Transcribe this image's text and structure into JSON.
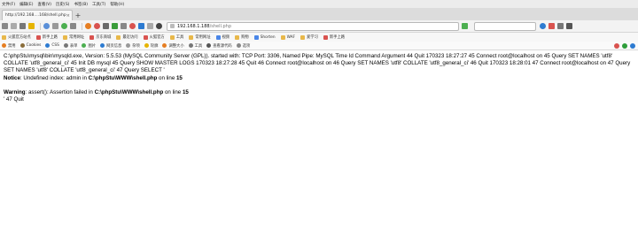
{
  "menu": {
    "items": [
      "文件(F)",
      "编辑(E)",
      "查看(V)",
      "历史(S)",
      "书签(B)",
      "工具(T)",
      "帮助(H)"
    ]
  },
  "tab": {
    "title": "http://192.168....168/shell.php",
    "close": "×",
    "new": "+"
  },
  "nav": {
    "url_host": "192.168.1.188",
    "url_path": "/shell.php"
  },
  "bookmarks": [
    "火狐官方站点",
    "新手上路",
    "常用网址",
    "京东商城",
    "最近访问",
    "火狐官方",
    "工具",
    "常用网址",
    "视频",
    "购物",
    "Shorten",
    "WAF",
    "爱学习",
    "新手上路"
  ],
  "devtools": [
    "禁用",
    "Cookies",
    "CSS",
    "表单",
    "图片",
    "网页信息",
    "杂项",
    "轮廓",
    "调整大小",
    "工具",
    "查看源代码",
    "选项"
  ],
  "page": {
    "log": "C:\\phpStu\\mysql\\bin\\mysqld.exe, Version: 5.5.53 (MySQL Community Server (GPL)). started with: TCP Port: 3306, Named Pipe: MySQL Time Id Command Argument 44 Quit 170323 18:27:27 45 Connect root@localhost on 45 Query SET NAMES 'utf8' COLLATE 'utf8_general_ci' 45 Init DB mysql 45 Query SHOW MASTER LOGS 170323 18:27:28 45 Quit 46 Connect root@localhost on 46 Query SET NAMES 'utf8' COLLATE 'utf8_general_ci' 46 Quit 170323 18:28:01 47 Connect root@localhost on 47 Query SET NAMES 'utf8' COLLATE 'utf8_general_ci' 47 Query SELECT '",
    "notice_label": "Notice",
    "notice_text": ": Undefined index: admin in ",
    "notice_path": "C:\\phpStu\\WWW\\shell.php",
    "notice_online": " on line ",
    "notice_line": "15",
    "warning_label": "Warning",
    "warning_text": ": assert(): Assertion failed in ",
    "warning_path": "C:\\phpStu\\WWW\\shell.php",
    "warning_online": " on line ",
    "warning_line": "15",
    "tail": "' 47 Quit"
  },
  "colors": {
    "accent_green": "#2e9d3a",
    "accent_red": "#d9534f",
    "accent_blue": "#2d7bd1"
  }
}
